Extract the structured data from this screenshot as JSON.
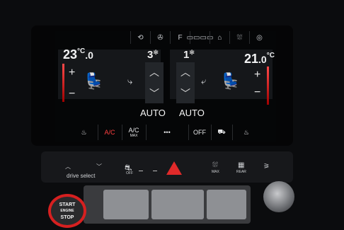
{
  "top_icons": [
    "recirculation-icon",
    "fan-icon",
    "seat-airflow-icon",
    "rear-window-heat-icon",
    "home-icon",
    "windshield-defrost-icon",
    "camera-icon"
  ],
  "top_labels": [
    "",
    "",
    "F",
    "▭▭▭▭",
    "⌂",
    "⛆",
    "◎"
  ],
  "left_zone": {
    "temp_main": "23",
    "temp_decimal": ".0",
    "unit": "°C",
    "fan_level": "3",
    "plus": "+",
    "minus": "−"
  },
  "right_zone": {
    "temp_main": "21",
    "temp_decimal": ".0",
    "unit": "°C",
    "fan_level": "1",
    "plus": "+",
    "minus": "−"
  },
  "auto_left": "AUTO",
  "auto_right": "AUTO",
  "bottom_bar": {
    "ac": "A/C",
    "ac_max": "A/C",
    "ac_max_sub": "MAX",
    "more": "•••",
    "off": "OFF"
  },
  "lower_panel": {
    "drive_select": "drive  select",
    "off_label": "OFF",
    "max_label": "MAX",
    "rear_label": "REAR"
  },
  "start_button": {
    "line1": "START",
    "line2": "ENGINE",
    "line3": "STOP"
  }
}
